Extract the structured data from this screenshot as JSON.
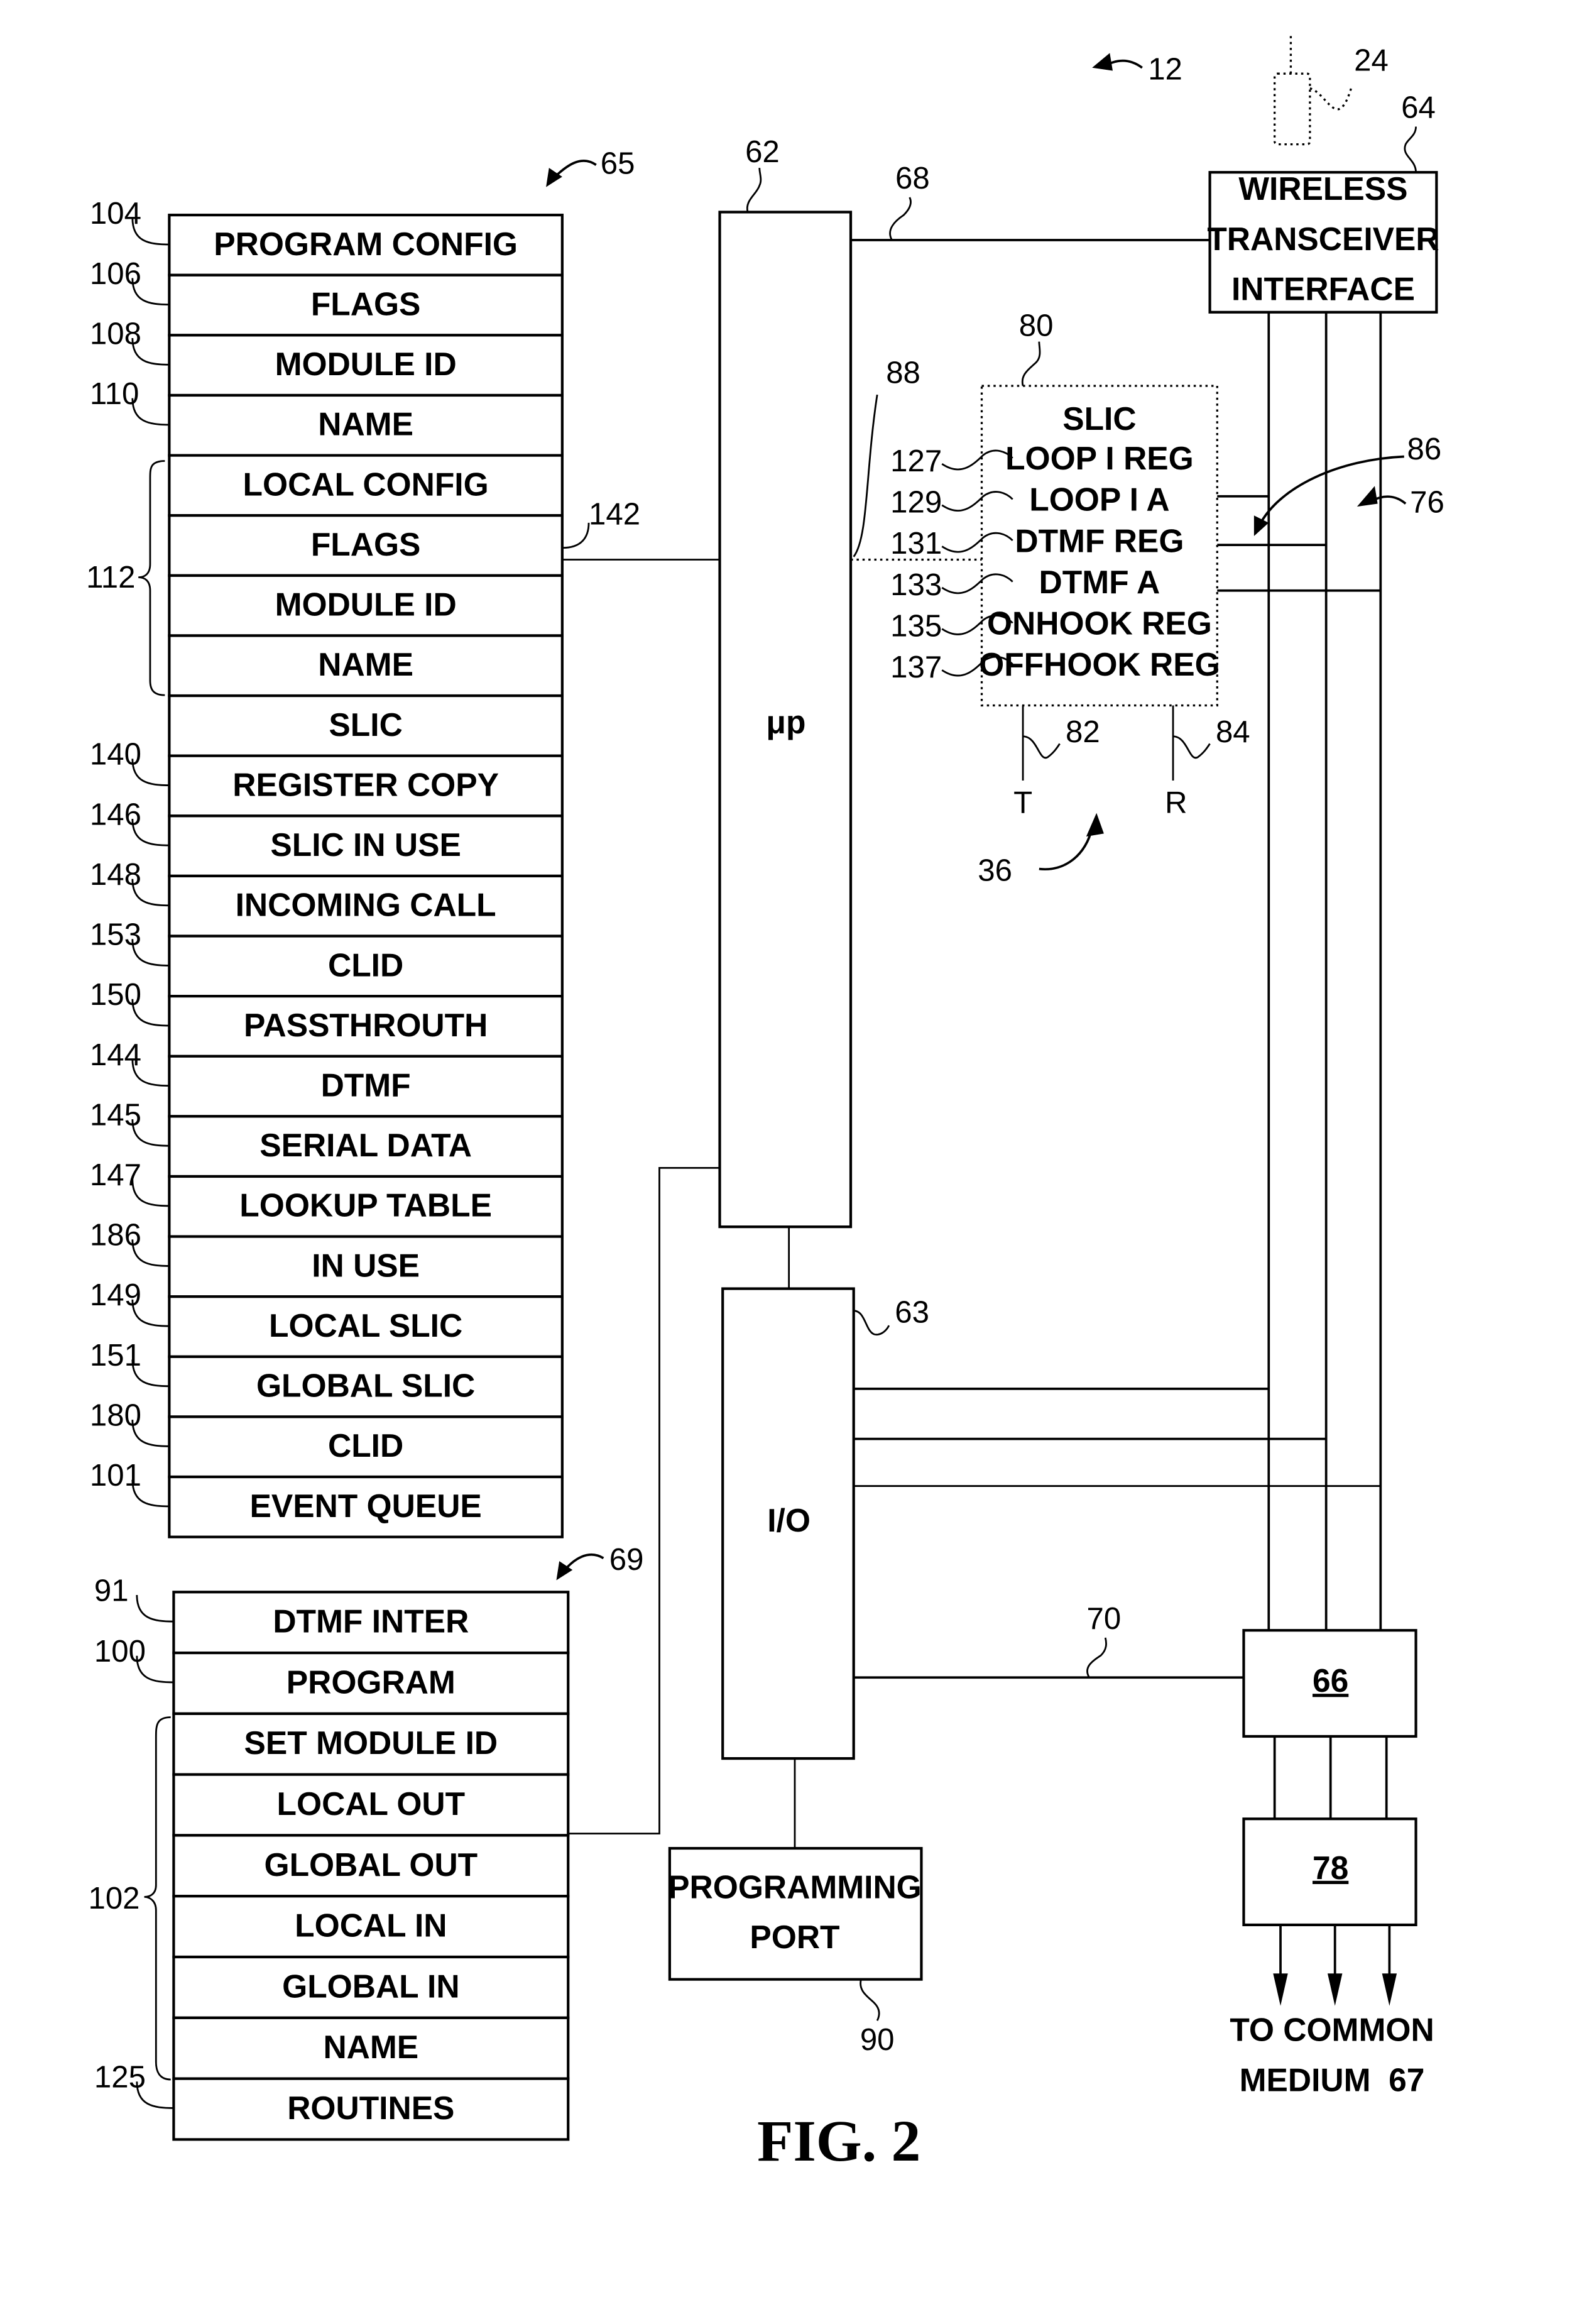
{
  "figure_label": "FIG. 2",
  "refs": {
    "device": "12",
    "antenna": "24",
    "transceiver": "64",
    "memory_65": "65",
    "memory_69": "69",
    "micro": "62",
    "bus_68": "68",
    "slic": "80",
    "line_88": "88",
    "bracket_86": "86",
    "bracket_76": "76",
    "tip_ref": "82",
    "ring_ref": "84",
    "slic_group": "36",
    "io_ref": "63",
    "bus_70": "70",
    "prog_port": "90",
    "flags_link": "142",
    "group_112": "112",
    "group_102": "102"
  },
  "memory_65": {
    "rows": [
      {
        "ref": "104",
        "label": "PROGRAM CONFIG"
      },
      {
        "ref": "106",
        "label": "FLAGS"
      },
      {
        "ref": "108",
        "label": "MODULE ID"
      },
      {
        "ref": "110",
        "label": "NAME"
      },
      {
        "ref": "",
        "label": "LOCAL CONFIG"
      },
      {
        "ref": "",
        "label": "FLAGS"
      },
      {
        "ref": "",
        "label": "MODULE ID"
      },
      {
        "ref": "",
        "label": "NAME"
      },
      {
        "ref": "",
        "label": "SLIC"
      },
      {
        "ref": "140",
        "label": "REGISTER COPY"
      },
      {
        "ref": "146",
        "label": "SLIC IN USE"
      },
      {
        "ref": "148",
        "label": "INCOMING CALL"
      },
      {
        "ref": "153",
        "label": "CLID"
      },
      {
        "ref": "150",
        "label": "PASSTHROUTH"
      },
      {
        "ref": "144",
        "label": "DTMF"
      },
      {
        "ref": "145",
        "label": "SERIAL DATA"
      },
      {
        "ref": "147",
        "label": "LOOKUP TABLE"
      },
      {
        "ref": "186",
        "label": "IN USE"
      },
      {
        "ref": "149",
        "label": "LOCAL SLIC"
      },
      {
        "ref": "151",
        "label": "GLOBAL SLIC"
      },
      {
        "ref": "180",
        "label": "CLID"
      },
      {
        "ref": "101",
        "label": "EVENT QUEUE"
      }
    ]
  },
  "memory_69": {
    "rows": [
      {
        "ref": "91",
        "label": "DTMF INTER"
      },
      {
        "ref": "100",
        "label": "PROGRAM"
      },
      {
        "ref": "",
        "label": "SET MODULE ID"
      },
      {
        "ref": "",
        "label": "LOCAL OUT"
      },
      {
        "ref": "",
        "label": "GLOBAL OUT"
      },
      {
        "ref": "",
        "label": "LOCAL IN"
      },
      {
        "ref": "",
        "label": "GLOBAL IN"
      },
      {
        "ref": "",
        "label": "NAME"
      },
      {
        "ref": "125",
        "label": "ROUTINES"
      }
    ]
  },
  "blocks": {
    "micro_label": "μp",
    "io_label": "I/O",
    "transceiver_lines": [
      "WIRELESS",
      "TRANSCEIVER",
      "INTERFACE"
    ],
    "prog_port_lines": [
      "PROGRAMMING",
      "PORT"
    ],
    "box_66": "66",
    "box_78": "78",
    "output_lines": [
      "TO COMMON",
      "MEDIUM  67"
    ]
  },
  "slic": {
    "title": "SLIC",
    "registers": [
      {
        "ref": "127",
        "label": "LOOP I REG"
      },
      {
        "ref": "129",
        "label": "LOOP I A"
      },
      {
        "ref": "131",
        "label": "DTMF REG"
      },
      {
        "ref": "133",
        "label": "DTMF A"
      },
      {
        "ref": "135",
        "label": "ONHOOK REG"
      },
      {
        "ref": "137",
        "label": "OFFHOOK REG"
      }
    ],
    "tip": "T",
    "ring": "R"
  }
}
